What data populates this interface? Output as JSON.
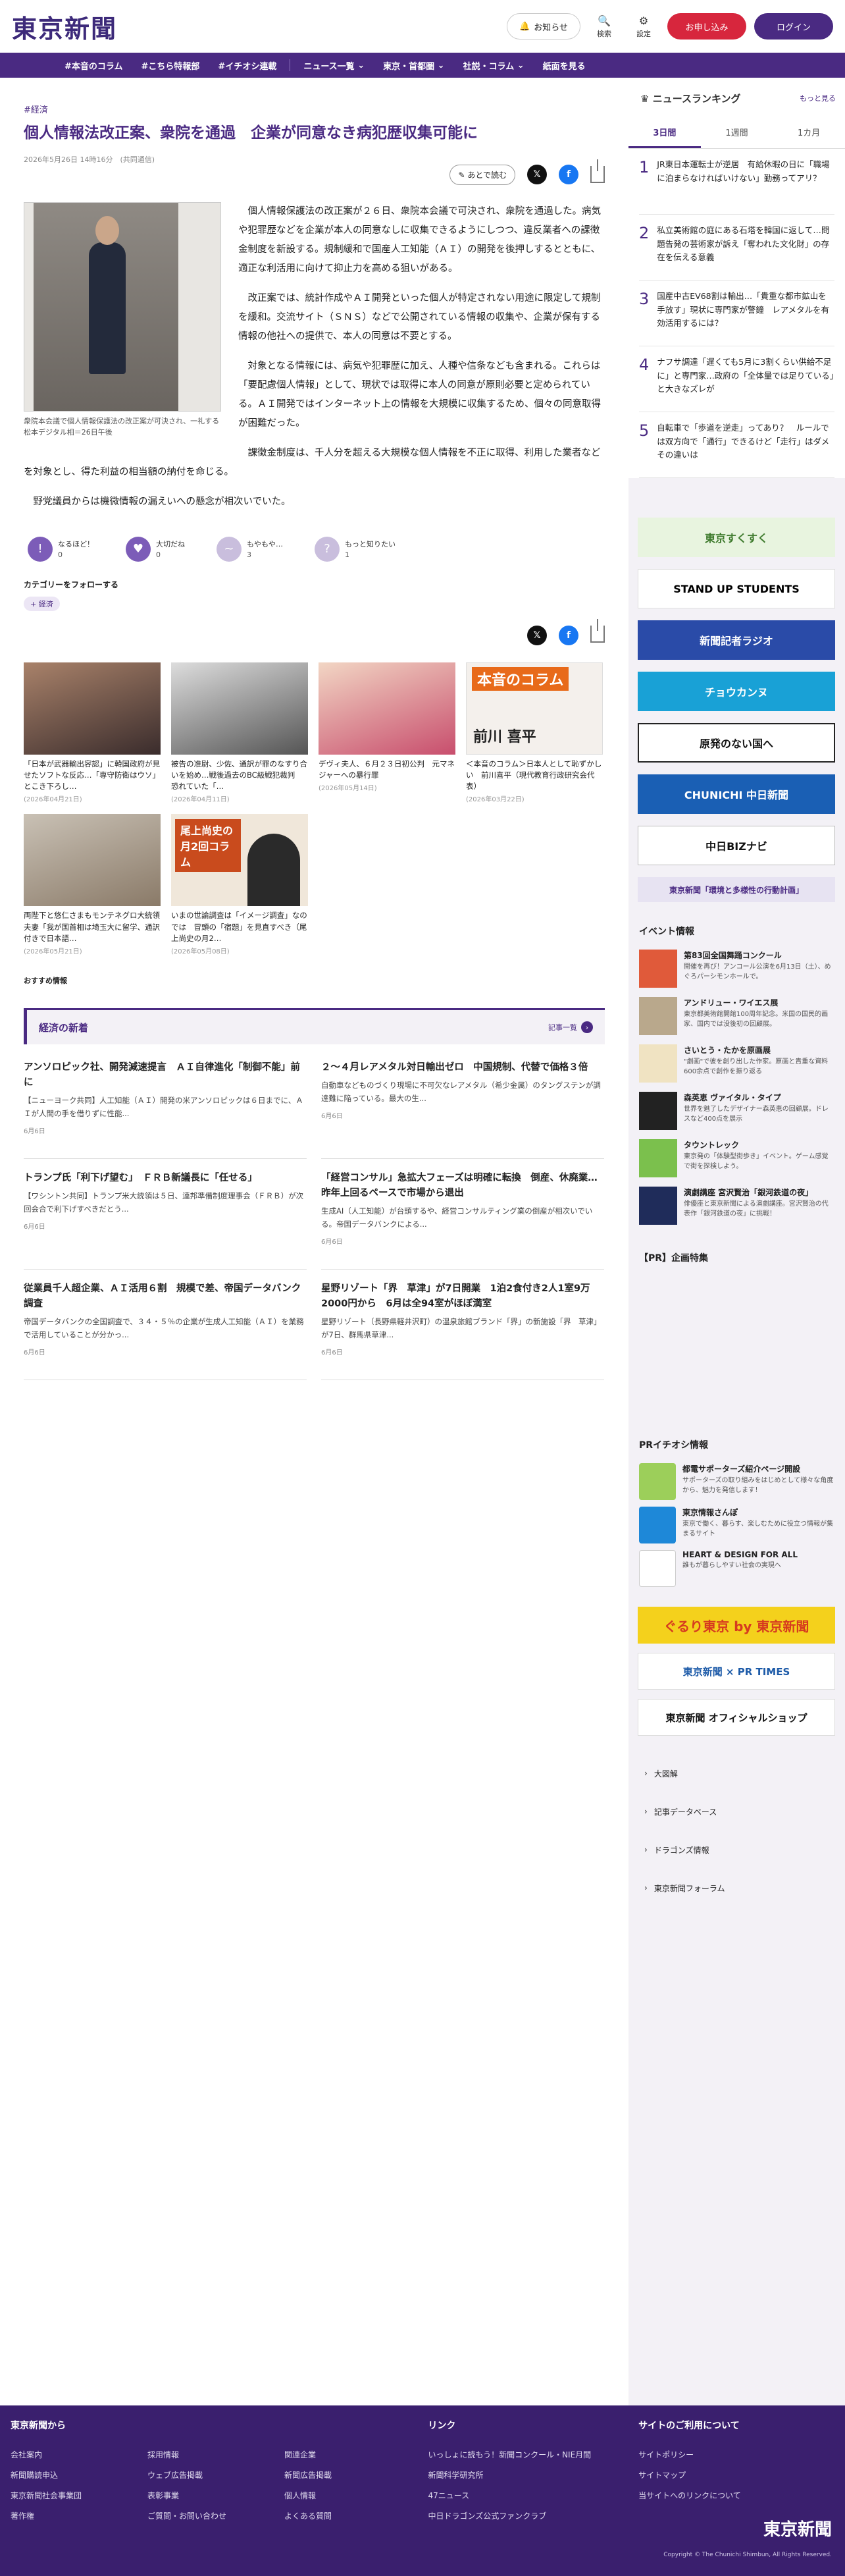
{
  "header": {
    "logo": "東京新聞",
    "notify": "お知らせ",
    "search": "検索",
    "settings": "設定",
    "subscribe": "お申し込み",
    "login": "ログイン"
  },
  "nav": [
    "#本音のコラム",
    "#こちら特報部",
    "#イチオシ連載",
    "ニュース一覧",
    "東京・首都圏",
    "社説・コラム",
    "紙面を見る"
  ],
  "article": {
    "breadcrumb": "#経済",
    "title": "個人情報法改正案、衆院を通過　企業が同意なき病犯歴収集可能に",
    "date": "2026年5月26日 14時16分　(共同通信)",
    "read_later": "あとで読む",
    "caption": "衆院本会議で個人情報保護法の改正案が可決され、一礼する松本デジタル相＝26日午後",
    "paragraphs": [
      "個人情報保護法の改正案が２６日、衆院本会議で可決され、衆院を通過した。病気や犯罪歴などを企業が本人の同意なしに収集できるようにしつつ、違反業者への課徴金制度を新設する。規制緩和で国産人工知能（ＡＩ）の開発を後押しするとともに、適正な利活用に向けて抑止力を高める狙いがある。",
      "改正案では、統計作成やＡＩ開発といった個人が特定されない用途に限定して規制を緩和。交流サイト（ＳＮＳ）などで公開されている情報の収集や、企業が保有する情報の他社への提供で、本人の同意は不要とする。",
      "対象となる情報には、病気や犯罪歴に加え、人種や信条なども含まれる。これらは「要配慮個人情報」として、現状では取得に本人の同意が原則必要と定められている。ＡＩ開発ではインターネット上の情報を大規模に収集するため、個々の同意取得が困難だった。",
      "課徴金制度は、千人分を超える大規模な個人情報を不正に取得、利用した業者などを対象とし、得た利益の相当額の納付を命じる。",
      "野党議員からは機微情報の漏えいへの懸念が相次いでいた。"
    ],
    "reactions": [
      {
        "label": "なるほど！",
        "count": "0"
      },
      {
        "label": "大切だね",
        "count": "0"
      },
      {
        "label": "もやもや…",
        "count": "3"
      },
      {
        "label": "もっと知りたい",
        "count": "1"
      }
    ],
    "follow_title": "カテゴリーをフォローする",
    "follow_tag": "+ 経済"
  },
  "related": [
    {
      "text": "「日本が武器輸出容認」に韓国政府が見せたソフトな反応…「専守防衛はウソ」とこき下ろし…",
      "date": "(2026年04月21日)"
    },
    {
      "text": "被告の准尉、少佐、通訳が罪のなすり合いを始め…戦後過去のBC級戦犯裁判　恐れていた「…",
      "date": "(2026年04月11日)"
    },
    {
      "text": "デヴィ夫人、６月２３日初公判　元マネジャーへの暴行罪",
      "date": "(2026年05月14日)"
    },
    {
      "text": "＜本音のコラム＞日本人として恥ずかしい　前川喜平（現代教育行政研究会代表）",
      "date": "(2026年03月22日)"
    },
    {
      "text": "両陛下と悠仁さまもモンテネグロ大統領夫妻「我が国首相は埼玉大に留学、通訳付きで日本語…",
      "date": "(2026年05月21日)"
    },
    {
      "text": "いまの世論調査は「イメージ調査」なのでは　冒頭の「宿題」を見直すべき（尾上尚史の月2…",
      "date": "(2026年05月08日)"
    }
  ],
  "column_name": "前川 喜平",
  "column_banner": "本音のコラム",
  "column2_banner": "尾上尚史の月2回コラム",
  "recommend": "おすすめ情報",
  "econ": {
    "title": "経済の新着",
    "more": "記事一覧",
    "items": [
      {
        "h": "アンソロピック社、開発減速提言　ＡＩ自律進化「制御不能」前に",
        "s": "【ニューヨーク共同】人工知能（ＡＩ）開発の米アンソロピックは６日までに、ＡＩが人間の手を借りずに性能...",
        "d": "6月6日"
      },
      {
        "h": "２～４月レアメタル対日輸出ゼロ　中国規制、代替で価格３倍",
        "s": "自動車などものづくり現場に不可欠なレアメタル（希少金属）のタングステンが調達難に陥っている。最大の生...",
        "d": "6月6日"
      },
      {
        "h": "トランプ氏「利下げ望む」　ＦＲＢ新議長に「任せる」",
        "s": "【ワシントン共同】トランプ米大統領は５日、連邦準備制度理事会（ＦＲＢ）が次回会合で利下げすべきだとう...",
        "d": "6月6日"
      },
      {
        "h": "「経営コンサル」急拡大フェーズは明確に転換　倒産、休廃業…昨年上回るペースで市場から退出",
        "s": "生成AI（人工知能）が台頭するや、経営コンサルティング業の倒産が相次いでいる。帝国データバンクによる...",
        "d": "6月6日"
      },
      {
        "h": "従業員千人超企業、ＡＩ活用６割　規模で差、帝国データバンク調査",
        "s": "帝国データバンクの全国調査で、３４・５％の企業が生成人工知能（ＡＩ）を業務で活用していることが分かっ...",
        "d": "6月6日"
      },
      {
        "h": "星野リゾート「界　草津」が7日開業　1泊2食付き2人1室9万2000円から　6月は全94室がほぼ満室",
        "s": "星野リゾート（長野県軽井沢町）の温泉旅館ブランド「界」の新施設「界　草津」が7日、群馬県草津...",
        "d": "6月6日"
      }
    ]
  },
  "ranking": {
    "title": "ニュースランキング",
    "more": "もっと見る",
    "tabs": [
      "3日間",
      "1週間",
      "1カ月"
    ],
    "items": [
      "JR東日本運転士が逆居　有給休暇の日に「職場に泊まらなければいけない」勤務ってアリ？",
      "私立美術館の庭にある石塔を韓国に返して…問題告発の芸術家が訴え「奪われた文化財」の存在を伝える意義",
      "国産中古EV68割は輸出…「貴重な都市鉱山を手放す」現状に専門家が警鐘　レアメタルを有効活用するには？",
      "ナフサ調達「遅くても5月に3割くらい供給不足に」と専門家…政府の「全体量では足りている」と大きなズレが",
      "自転車で「歩道を逆走」ってあり？　ルールでは双方向で「通行」できるけど「走行」はダメ　その違いは"
    ]
  },
  "banners": [
    "東京すくすく",
    "STAND UP STUDENTS",
    "新聞記者ラジオ",
    "チョウカンヌ",
    "原発のない国へ",
    "CHUNICHI 中日新聞",
    "中日BIZナビ",
    "東京新聞「環境と多様性の行動計画」"
  ],
  "events_title": "イベント情報",
  "events": [
    {
      "t": "第83回全国舞踊コンクール",
      "s": "開催を再び！アンコール公演を6月13日（土）、めぐろパーシモンホールで。"
    },
    {
      "t": "アンドリュー・ワイエス展",
      "s": "東京都美術館開館100周年記念。米国の国民的画家、国内では没後初の回顧展。"
    },
    {
      "t": "さいとう・たかを原画展",
      "s": "\"劇画\"で彼を創り出した作家。原画と貴重な資料600余点で創作を振り返る"
    },
    {
      "t": "森英恵 ヴァイタル・タイプ",
      "s": "世界を魅了したデザイナー森英恵の回顧展。ドレスなど400点を展示"
    },
    {
      "t": "タウントレック",
      "s": "東京発の「体験型街歩き」イベント。ゲーム感覚で街を探検しよう。"
    },
    {
      "t": "演劇講座 宮沢賢治「銀河鉄道の夜」",
      "s": "俳優座と東京新聞による演劇講座。宮沢賢治の代表作「銀河鉄道の夜」に挑戦！"
    }
  ],
  "pr_title": "【PR】企画特集",
  "pr_info_title": "PRイチオシ情報",
  "pr_items": [
    {
      "t": "都電サポーターズ紹介ページ開設",
      "s": "サポーターズの取り組みをはじめとして様々な角度から、魅力を発信します！"
    },
    {
      "t": "東京情報さんぽ",
      "s": "東京で働く、暮らす、楽しむために役立つ情報が集まるサイト"
    },
    {
      "t": "HEART & DESIGN FOR ALL",
      "s": "誰もが暮らしやすい社会の実現へ"
    }
  ],
  "side_banners": [
    "ぐるり東京 by 東京新聞",
    "東京新聞 × PR TIMES",
    "東京新聞 オフィシャルショップ"
  ],
  "side_links": [
    "大図解",
    "記事データベース",
    "ドラゴンズ情報",
    "東京新聞フォーラム"
  ],
  "footer": {
    "col1_title": "東京新聞から",
    "col1": [
      "会社案内",
      "採用情報",
      "関連企業",
      "新聞購読申込",
      "ウェブ広告掲載",
      "新聞広告掲載",
      "東京新聞社会事業団",
      "表彰事業",
      "個人情報",
      "著作権",
      "ご質問・お問い合わせ",
      "よくある質問"
    ],
    "col2_title": "リンク",
    "col2": [
      "いっしょに読もう！新聞コンクール・NIE月間",
      "新聞科学研究所",
      "47ニュース",
      "中日ドラゴンズ公式ファンクラブ"
    ],
    "col3_title": "サイトのご利用について",
    "col3": [
      "サイトポリシー",
      "サイトマップ",
      "当サイトへのリンクについて"
    ],
    "logo": "東京新聞",
    "copyright": "Copyright © The Chunichi Shimbun, All Rights Reserved."
  },
  "colors": {
    "brand": "#4a2a82",
    "subscribe": "#d7263d",
    "footer": "#3a1f6e"
  }
}
